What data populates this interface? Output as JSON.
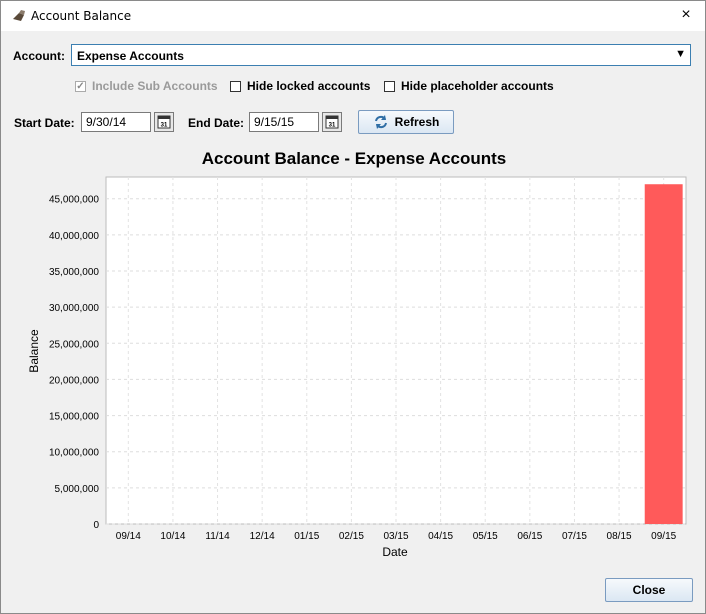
{
  "window": {
    "title": "Account Balance",
    "close_glyph": "×"
  },
  "account": {
    "label": "Account:",
    "selected": "Expense Accounts"
  },
  "options": {
    "include_sub": {
      "label": "Include Sub Accounts",
      "checked": true,
      "enabled": false
    },
    "hide_locked": {
      "label": "Hide locked accounts",
      "checked": false
    },
    "hide_placeholder": {
      "label": "Hide placeholder accounts",
      "checked": false
    }
  },
  "dates": {
    "start_label": "Start Date:",
    "start_value": "9/30/14",
    "end_label": "End Date:",
    "end_value": "9/15/15",
    "calendar_glyph": "31"
  },
  "refresh": {
    "label": "Refresh"
  },
  "close": {
    "label": "Close"
  },
  "colors": {
    "bar": "#ff5a5a",
    "accent": "#3c7fb1"
  },
  "chart_data": {
    "type": "bar",
    "title": "Account Balance - Expense Accounts",
    "xlabel": "Date",
    "ylabel": "Balance",
    "ylim": [
      0,
      48000000
    ],
    "yticks": [
      "0",
      "5,000,000",
      "10,000,000",
      "15,000,000",
      "20,000,000",
      "25,000,000",
      "30,000,000",
      "35,000,000",
      "40,000,000",
      "45,000,000"
    ],
    "categories": [
      "09/14",
      "10/14",
      "11/14",
      "12/14",
      "01/15",
      "02/15",
      "03/15",
      "04/15",
      "05/15",
      "06/15",
      "07/15",
      "08/15",
      "09/15"
    ],
    "values": [
      0,
      0,
      0,
      0,
      0,
      0,
      0,
      0,
      0,
      0,
      0,
      0,
      47000000
    ],
    "grid": true
  }
}
